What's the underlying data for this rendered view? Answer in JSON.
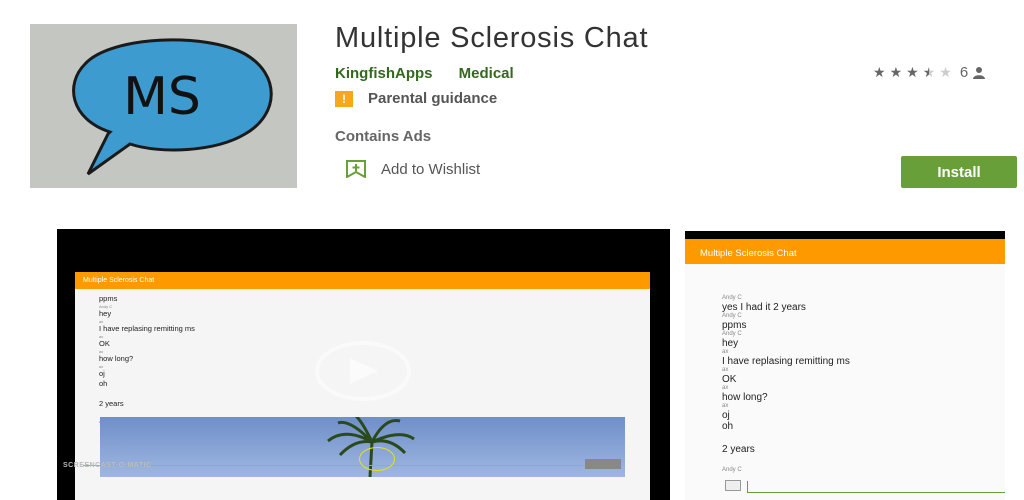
{
  "app": {
    "icon_text": "MS",
    "title": "Multiple Sclerosis Chat",
    "developer": "KingfishApps",
    "category": "Medical",
    "rating_stars": 3.5,
    "rating_count": "6",
    "content_rating": "Parental guidance",
    "content_rating_badge": "!",
    "ads_notice": "Contains Ads",
    "wishlist_label": "Add to Wishlist",
    "install_label": "Install"
  },
  "colors": {
    "developer_green": "#33691e",
    "install_green": "#689f38",
    "app_bar_orange": "#fe9a00",
    "badge_orange": "#f6a71b",
    "bubble_blue": "#3e9bd0"
  },
  "video_screenshot": {
    "app_bar_title": "Multiple Sclerosis Chat",
    "messages": [
      {
        "sender": "",
        "text": "ppms"
      },
      {
        "sender": "Andy C",
        "text": "hey"
      },
      {
        "sender": "ax",
        "text": "I have replasing remitting ms"
      },
      {
        "sender": "ax",
        "text": "OK"
      },
      {
        "sender": "ax",
        "text": "how long?"
      },
      {
        "sender": "ax",
        "text": "oj"
      },
      {
        "sender": "",
        "text": "oh"
      },
      {
        "sender": "",
        "text": "2 years"
      },
      {
        "sender": "Andy C",
        "text": ""
      }
    ],
    "watermark": "SCREENCAST-O-MATIC"
  },
  "phone_screenshot": {
    "app_bar_title": "Multiple Sclerosis Chat",
    "messages": [
      {
        "sender": "Andy C",
        "text": "yes I had it 2 years"
      },
      {
        "sender": "Andy C",
        "text": "ppms"
      },
      {
        "sender": "Andy C",
        "text": "hey"
      },
      {
        "sender": "ax",
        "text": "I have replasing remitting ms"
      },
      {
        "sender": "ax",
        "text": "OK"
      },
      {
        "sender": "ax",
        "text": "how long?"
      },
      {
        "sender": "ax",
        "text": "oj"
      },
      {
        "sender": "",
        "text": "oh"
      },
      {
        "sender": "",
        "text": "2 years"
      },
      {
        "sender": "Andy C",
        "text": ""
      }
    ]
  }
}
